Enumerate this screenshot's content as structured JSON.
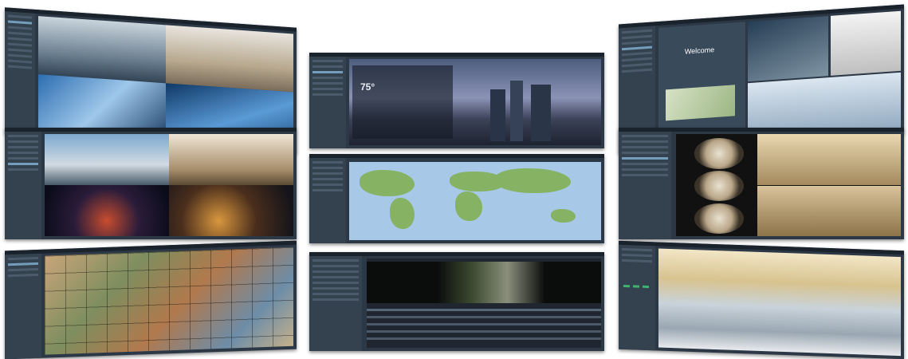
{
  "overlay_texts": {
    "welcome": "Welcome",
    "temperature": "75°"
  },
  "colors": {
    "window_bg": "#2c3846",
    "sidebar_bg": "#34414f",
    "titlebar": "#1a222c",
    "accent_green": "#3fb36b"
  },
  "panels": [
    {
      "id": "top-left",
      "content": "four-camera-grid-buildings"
    },
    {
      "id": "top-middle",
      "content": "city-skyline-weather-dashboard"
    },
    {
      "id": "top-right",
      "content": "welcome-kiosk-mosaic"
    },
    {
      "id": "middle-left",
      "content": "four-camera-grid-city-night"
    },
    {
      "id": "middle-middle",
      "content": "world-map-view"
    },
    {
      "id": "middle-right",
      "content": "fisheye-camera-views"
    },
    {
      "id": "bottom-left",
      "content": "multi-camera-wall-grid"
    },
    {
      "id": "bottom-middle",
      "content": "playback-with-event-table"
    },
    {
      "id": "bottom-right",
      "content": "airport-terminal-camera"
    }
  ]
}
